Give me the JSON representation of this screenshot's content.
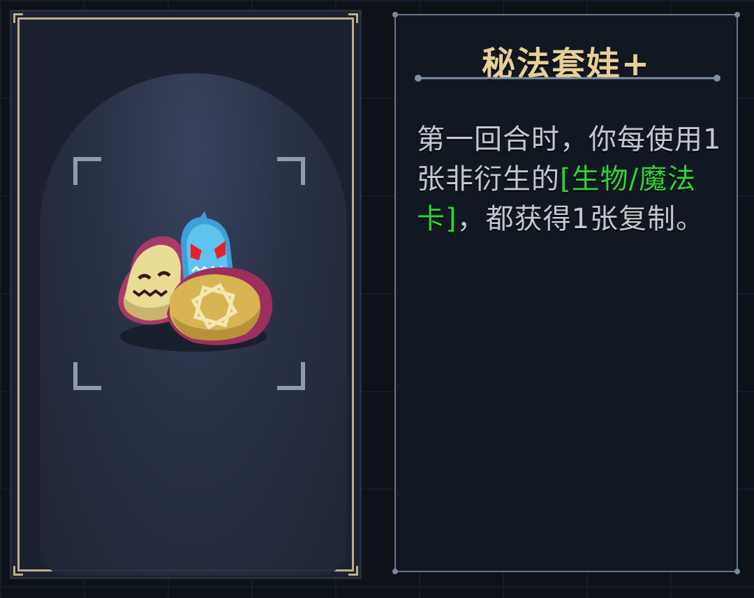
{
  "card": {
    "title": "秘法套娃+",
    "description": {
      "part1": "第一回合时，你每使用1张非衍生的",
      "keyword": "[生物/魔法卡]",
      "part2": "，都获得1张复制。"
    }
  },
  "colors": {
    "title": "#e8cf95",
    "body_text": "#c3c8d0",
    "keyword": "#2fd23a",
    "frame_gold": "#c2ad8c",
    "panel_bg": "#111822"
  },
  "icons": {
    "card_art": "nesting-dolls-icon"
  }
}
